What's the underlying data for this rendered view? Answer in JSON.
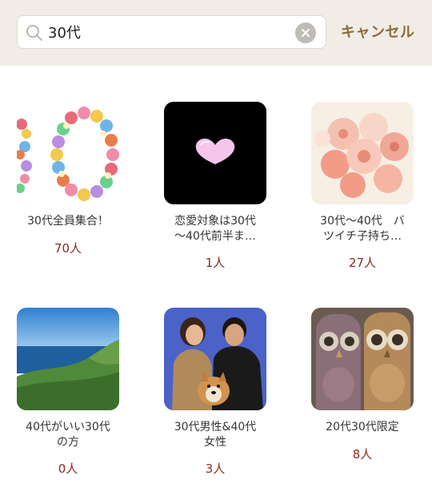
{
  "search": {
    "value": "30代",
    "cancel_label": "キャンセル"
  },
  "communities": [
    {
      "title": "30代全員集合！",
      "count": "70人",
      "image": "flower-numbers-30"
    },
    {
      "title": "恋愛対象は30代\n～40代前半ま…",
      "count": "1人",
      "image": "pink-heart"
    },
    {
      "title": "30代～40代　バ\nツイチ子持ち…",
      "count": "27人",
      "image": "rose-bouquet"
    },
    {
      "title": "40代がいい30代\nの方",
      "count": "0人",
      "image": "sea-cliff"
    },
    {
      "title": "30代男性&40代\n女性",
      "count": "3人",
      "image": "couple-with-dog"
    },
    {
      "title": "20代30代限定",
      "count": "8人",
      "image": "owl-figurines"
    }
  ],
  "colors": {
    "accent": "#8d6a38",
    "count": "#8b2a21",
    "header_bg": "#f1ede6"
  }
}
